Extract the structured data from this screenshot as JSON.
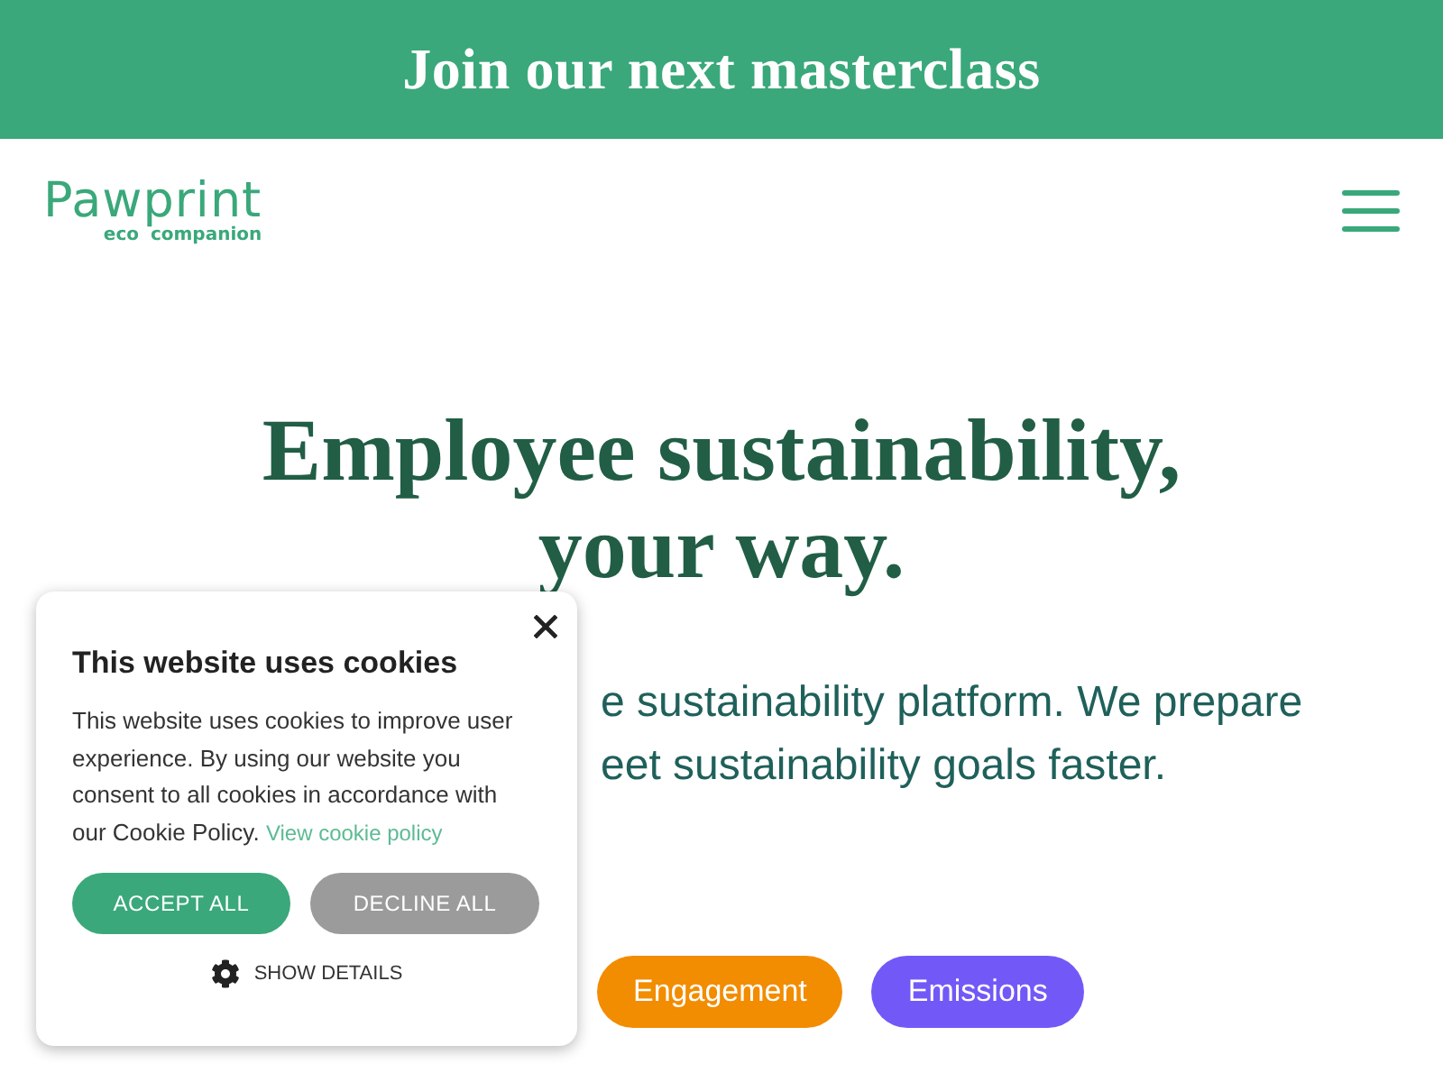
{
  "banner": {
    "text": "Join our next masterclass"
  },
  "header": {
    "logo": {
      "name": "Pawprint",
      "tagline": "eco companion"
    }
  },
  "hero": {
    "title_lines": [
      "Employee sustainability,",
      "your way."
    ],
    "subtitle_lines": [
      "e sustainability platform. We prepare",
      "eet sustainability goals faster."
    ],
    "tags": [
      {
        "label": "Engagement",
        "color": "#f28c00"
      },
      {
        "label": "Emissions",
        "color": "#7259f7"
      }
    ]
  },
  "cookie_banner": {
    "title": "This website uses cookies",
    "body": "This website uses cookies to improve user experience. By using our website you consent to all cookies in accordance with our Cookie Policy.",
    "link": "View cookie policy",
    "buttons": [
      {
        "label": "ACCEPT ALL",
        "kind": "primary"
      },
      {
        "label": "DECLINE ALL",
        "kind": "secondary"
      }
    ],
    "details": "SHOW DETAILS"
  }
}
